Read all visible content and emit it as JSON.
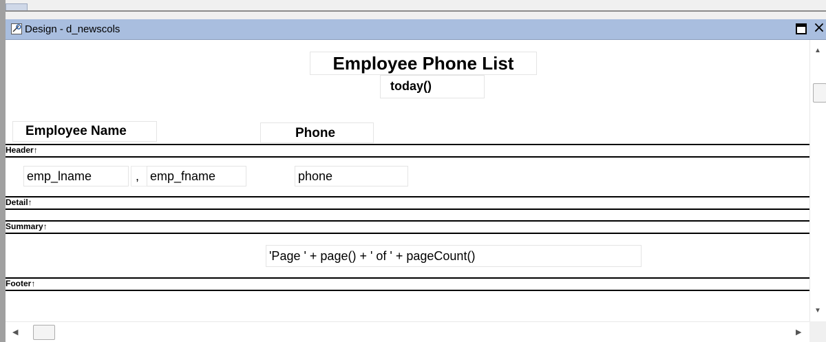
{
  "window": {
    "title": "Design - d_newscols",
    "maximize_symbol": "",
    "close_symbol": "×"
  },
  "header": {
    "report_title": "Employee Phone List",
    "date_expr": "today()",
    "col_name_heading": "Employee Name",
    "col_phone_heading": "Phone"
  },
  "detail": {
    "field_lname": "emp_lname",
    "separator": ",",
    "field_fname": "emp_fname",
    "field_phone": "phone"
  },
  "footer": {
    "page_expr": "'Page ' + page() + ' of ' + pageCount()"
  },
  "bands": {
    "header": "Header↑",
    "detail": "Detail↑",
    "summary": "Summary↑",
    "footer": "Footer↑"
  },
  "scroll": {
    "up": "▲",
    "down": "▼",
    "left": "◀",
    "right": "▶"
  }
}
